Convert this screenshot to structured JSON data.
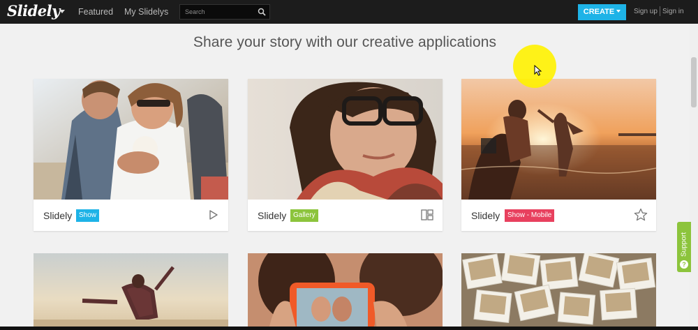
{
  "header": {
    "logo": "Slidely",
    "nav": [
      "Featured",
      "My Slidelys"
    ],
    "search_placeholder": "Search",
    "create_label": "CREATE",
    "sign_up": "Sign up",
    "sign_in": "Sign in"
  },
  "headline": "Share your story with our creative applications",
  "cards": [
    {
      "brand": "Slidely",
      "tag": "Show",
      "tag_color": "#1eb3e7",
      "icon": "play-icon"
    },
    {
      "brand": "Slidely",
      "tag": "Gallery",
      "tag_color": "#8cc43c",
      "icon": "gallery-layout-icon"
    },
    {
      "brand": "Slidely",
      "tag": "Show - Mobile",
      "tag_color": "#e8405e",
      "icon": "star-icon"
    }
  ],
  "support": {
    "label": "Support"
  },
  "colors": {
    "accent": "#1eb3e7",
    "gallery": "#8cc43c",
    "mobile": "#e8405e",
    "topbar": "#1c1c1c"
  }
}
